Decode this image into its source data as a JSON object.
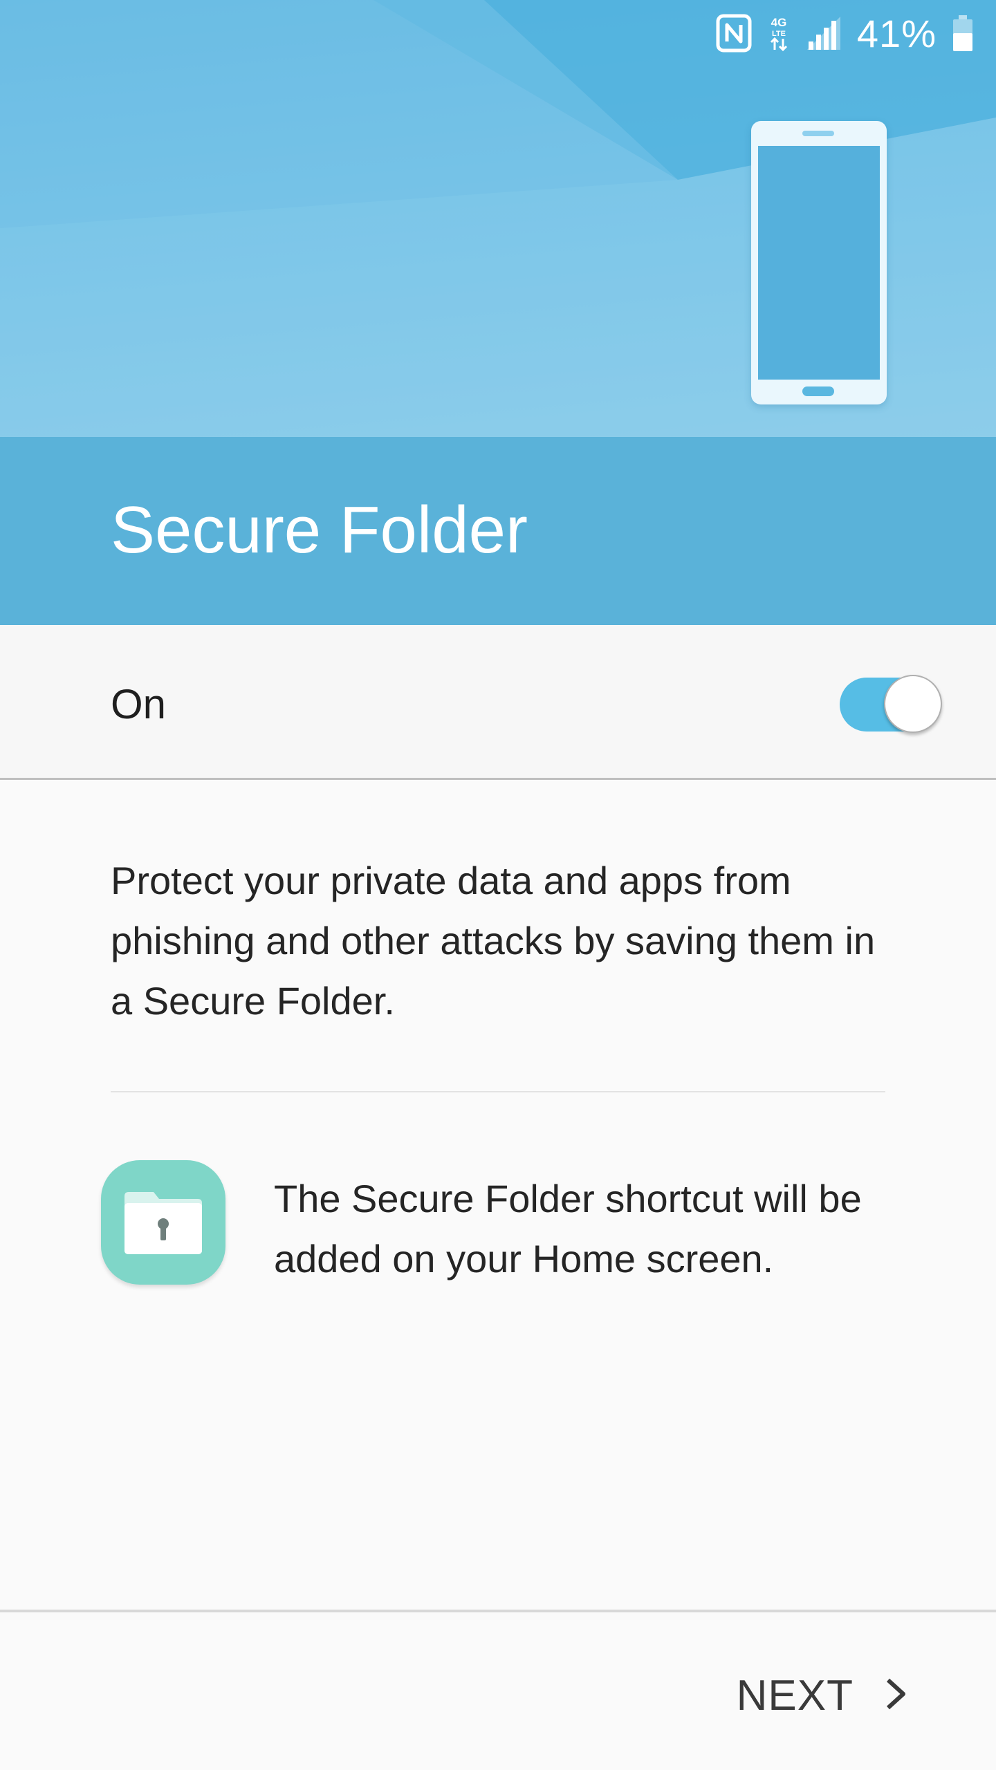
{
  "status_bar": {
    "battery_percent": "41%",
    "icons": [
      "nfc-icon",
      "network-4g-lte-icon",
      "signal-icon",
      "battery-icon"
    ]
  },
  "header": {
    "title": "Secure Folder"
  },
  "toggle_row": {
    "label": "On",
    "state": true
  },
  "main": {
    "description": "Protect your private data and apps from phishing and other attacks by saving them in a Secure Folder.",
    "shortcut_text": "The Secure Folder shortcut will be added on your Home screen.",
    "shortcut_icon": "secure-folder-icon"
  },
  "footer": {
    "next_label": "NEXT",
    "next_icon": "chevron-right-icon"
  },
  "colors": {
    "hero": "#6fbfe5",
    "title_bar": "#5ab2d9",
    "toggle_accent": "#56bde5",
    "folder_icon": "#7fd6c8"
  }
}
